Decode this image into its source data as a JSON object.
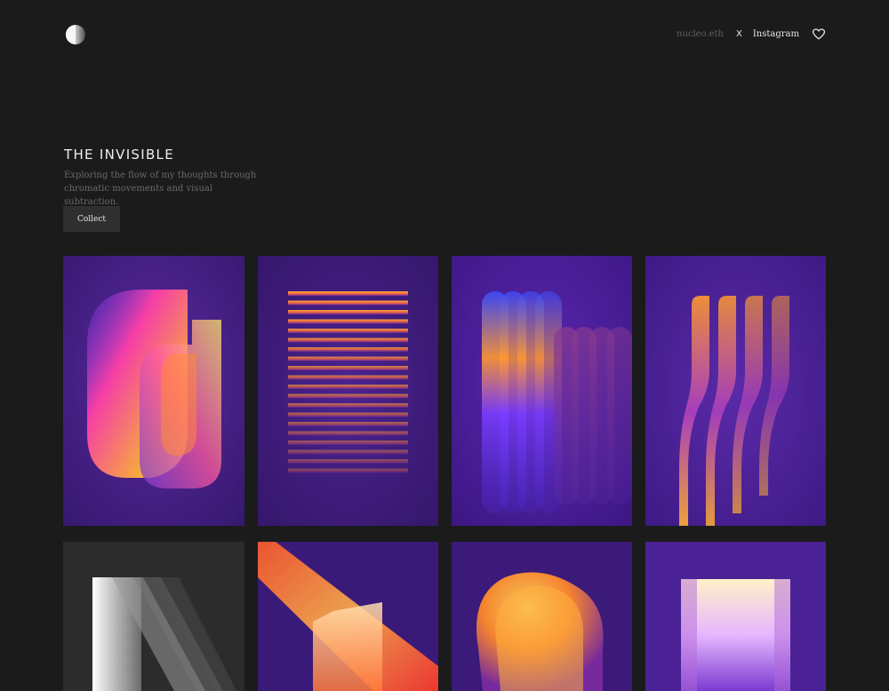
{
  "header": {
    "logo_icon": "half-circle-logo-icon",
    "nav": {
      "ens_label": "nucleo.eth",
      "x_label": "X",
      "instagram_label": "Instagram",
      "favorite_icon": "heart-icon"
    }
  },
  "hero": {
    "title": "THE INVISIBLE",
    "description": "Exploring the flow of my thoughts through chromatic movements and visual subtraction.",
    "collect_label": "Collect"
  },
  "gallery": {
    "artworks": [
      {
        "name": "artwork-1"
      },
      {
        "name": "artwork-2"
      },
      {
        "name": "artwork-3"
      },
      {
        "name": "artwork-4"
      },
      {
        "name": "artwork-5"
      },
      {
        "name": "artwork-6"
      },
      {
        "name": "artwork-7"
      },
      {
        "name": "artwork-8"
      }
    ]
  },
  "colors": {
    "background": "#1b1b1b",
    "button": "#2f2f2f",
    "muted_text": "#6a6a6a",
    "art_purple": "#4a1f8a",
    "art_orange": "#ff8a2a",
    "art_yellow": "#ffd24a",
    "art_pink": "#ff3fa8"
  }
}
